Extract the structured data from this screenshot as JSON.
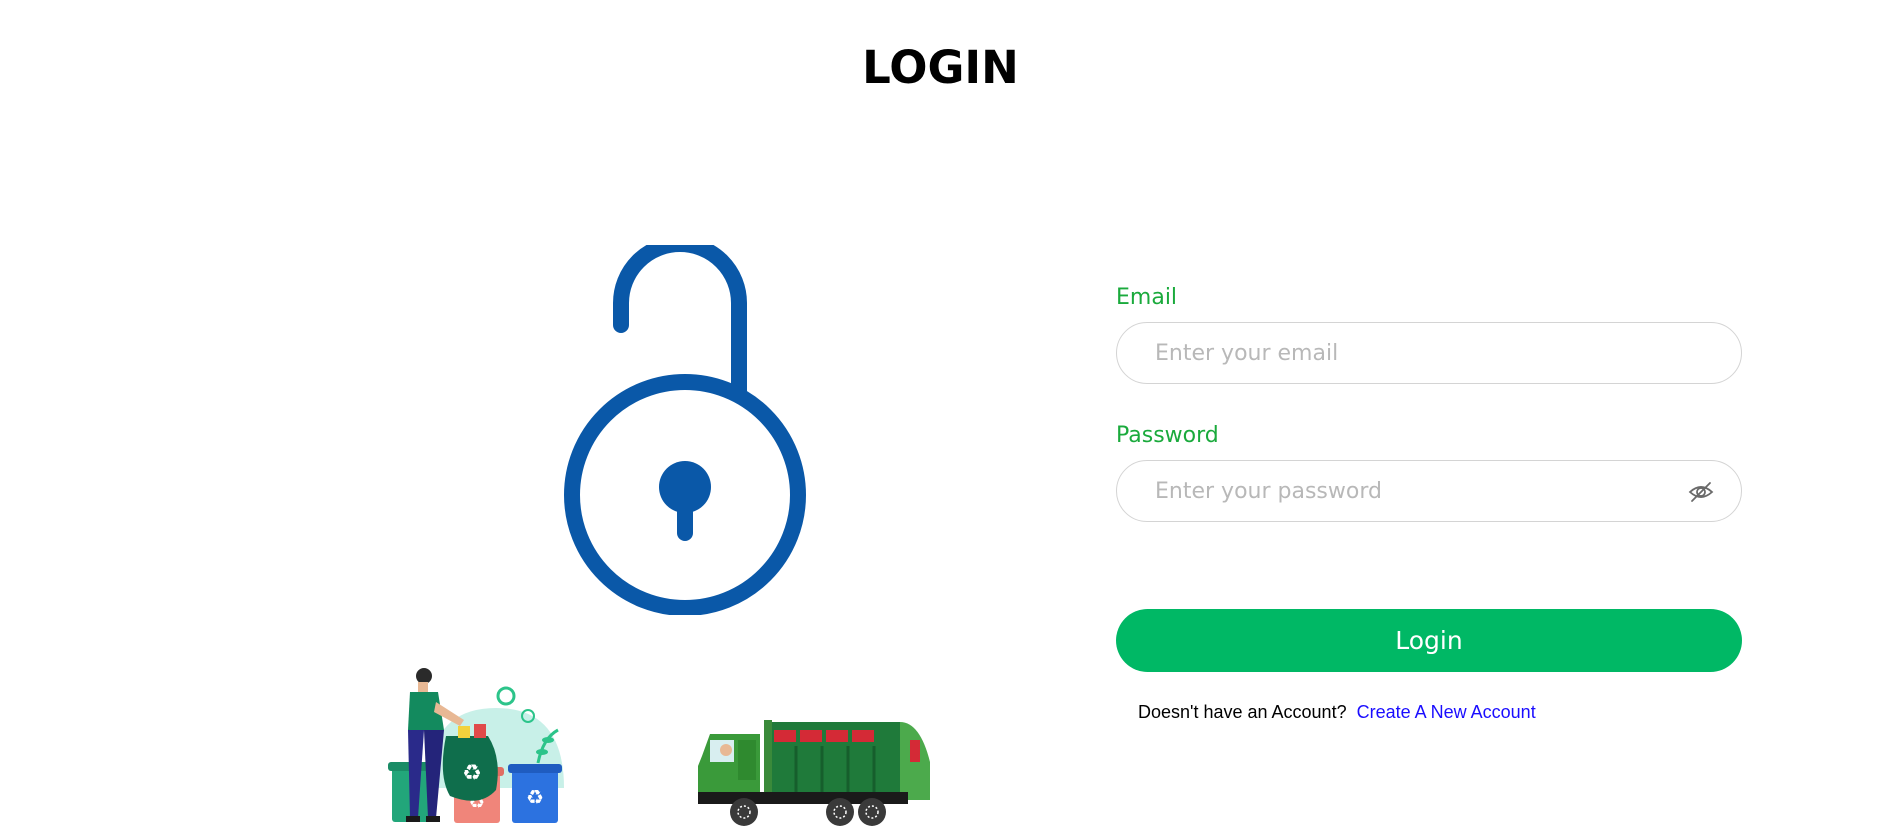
{
  "page": {
    "title": "LOGIN"
  },
  "colors": {
    "accent_green": "#00b865",
    "label_green": "#1aaa3c",
    "lock_blue": "#0a58a8",
    "link_blue": "#1a0dff"
  },
  "illustrations": {
    "lock": "unlocked-padlock-icon",
    "recycling": "person-recycling-bins-illustration",
    "truck": "garbage-truck-illustration"
  },
  "form": {
    "email": {
      "label": "Email",
      "placeholder": "Enter your email",
      "value": ""
    },
    "password": {
      "label": "Password",
      "placeholder": "Enter your password",
      "value": "",
      "toggle_icon": "eye-slash-icon"
    },
    "submit_label": "Login",
    "signup": {
      "prompt": "Doesn't have an Account?",
      "link_label": "Create A New Account"
    }
  }
}
